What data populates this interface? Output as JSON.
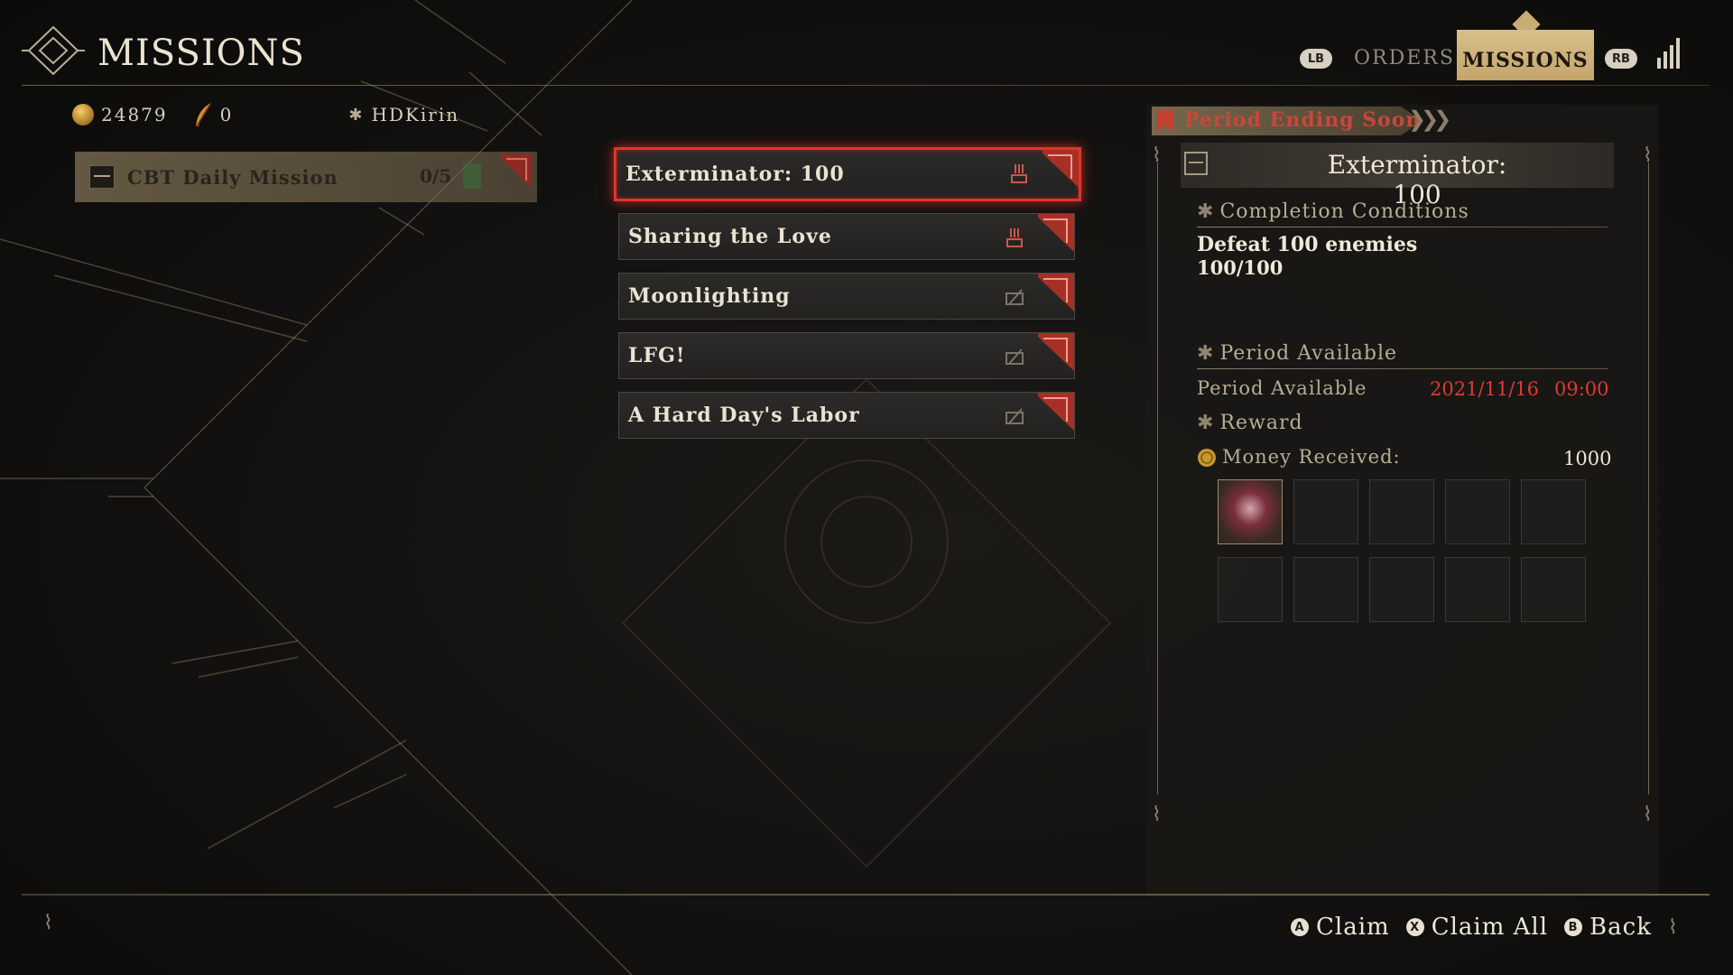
{
  "header": {
    "title": "MISSIONS",
    "tabs": {
      "lb": "LB",
      "orders": "ORDERS",
      "missions": "MISSIONS",
      "rb": "RB"
    }
  },
  "currency": {
    "gold": "24879",
    "feathers": "0",
    "username": "HDKirin"
  },
  "categories": [
    {
      "label": "CBT Daily Mission",
      "progress": "0/5"
    }
  ],
  "missions": [
    {
      "label": "Exterminator: 100",
      "status": "claimable",
      "selected": true
    },
    {
      "label": "Sharing the Love",
      "status": "claimable",
      "selected": false
    },
    {
      "label": "Moonlighting",
      "status": "in-progress",
      "selected": false
    },
    {
      "label": "LFG!",
      "status": "in-progress",
      "selected": false
    },
    {
      "label": "A Hard Day's Labor",
      "status": "in-progress",
      "selected": false
    }
  ],
  "detail": {
    "banner": "Period Ending Soon",
    "title": "Exterminator: 100",
    "completion_head": "Completion Conditions",
    "condition": "Defeat 100 enemies",
    "condition_progress": "100/100",
    "period_head": "Period Available",
    "period_label": "Period Available",
    "period_date": "2021/11/16",
    "period_time": "09:00",
    "reward_head": "Reward",
    "money_label": "Money Received:",
    "money_value": "1000",
    "reward_slots_filled": 1,
    "reward_slots_total": 10
  },
  "footer": {
    "claim_glyph": "A",
    "claim": "Claim",
    "claim_all_glyph": "X",
    "claim_all": "Claim All",
    "back_glyph": "B",
    "back": "Back"
  },
  "colors": {
    "accent_red": "#e2342a",
    "gold_tab": "#c4a56c",
    "date_red": "#e03a32"
  }
}
